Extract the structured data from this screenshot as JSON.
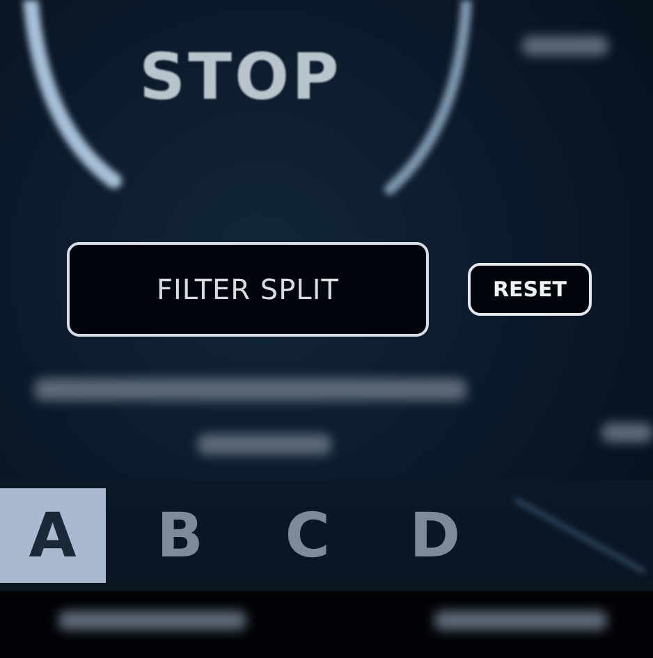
{
  "display": {
    "title": "STOP"
  },
  "filter_button": {
    "label": "FILTER SPLIT"
  },
  "reset_button": {
    "label": "RESET"
  },
  "tabs": [
    {
      "label": "A",
      "selected": true
    },
    {
      "label": "B",
      "selected": false
    },
    {
      "label": "C",
      "selected": false
    },
    {
      "label": "D",
      "selected": false
    }
  ]
}
